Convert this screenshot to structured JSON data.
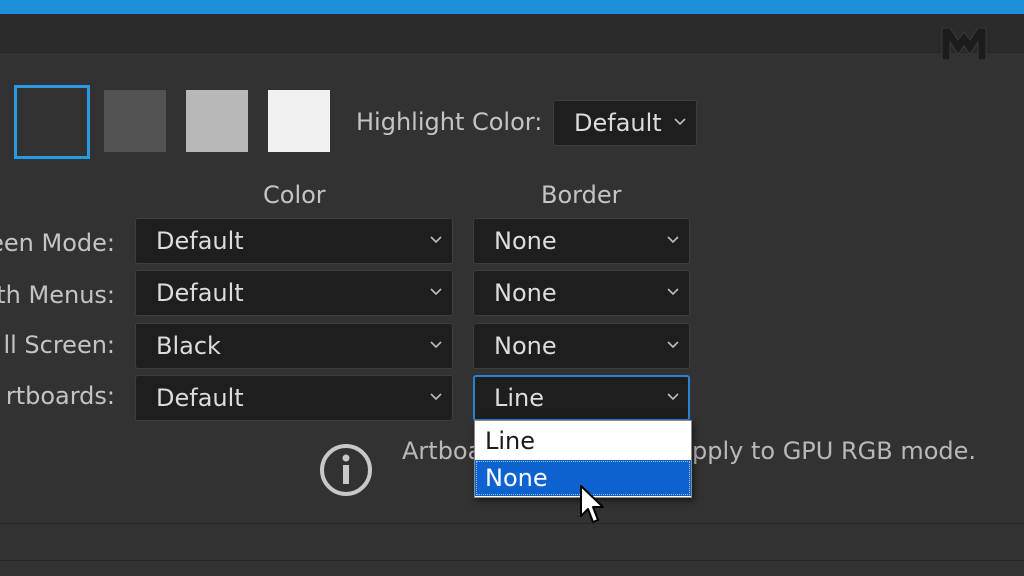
{
  "colors": {
    "accent": "#1d8fdb",
    "swatch_darkest": "#323232",
    "swatch_medium_dark": "#535353",
    "swatch_medium_light": "#b8b8b8",
    "swatch_light": "#f0f0f0",
    "dropdown_highlight": "#0e63d1"
  },
  "brightness": {
    "swatches": [
      "darkest",
      "medium-dark",
      "medium-light",
      "light"
    ],
    "selected": "darkest"
  },
  "highlight": {
    "label": "Highlight Color:",
    "value": "Default"
  },
  "columns": {
    "color": "Color",
    "border": "Border"
  },
  "rows": [
    {
      "label": "een Mode:",
      "color": "Default",
      "border": "None"
    },
    {
      "label": "th Menus:",
      "color": "Default",
      "border": "None"
    },
    {
      "label": "ll Screen:",
      "color": "Black",
      "border": "None"
    },
    {
      "label": "rtboards:",
      "color": "Default",
      "border": "Line"
    }
  ],
  "border_dropdown_open": {
    "options": [
      "Line",
      "None"
    ],
    "hovered": "None"
  },
  "note": {
    "text_left": "Artboa",
    "text_right": "pply to GPU RGB mode."
  },
  "icons": {
    "logo": "brand-logo-icon",
    "info": "info-icon",
    "chevron": "chevron-down-icon",
    "cursor": "mouse-pointer-icon"
  }
}
